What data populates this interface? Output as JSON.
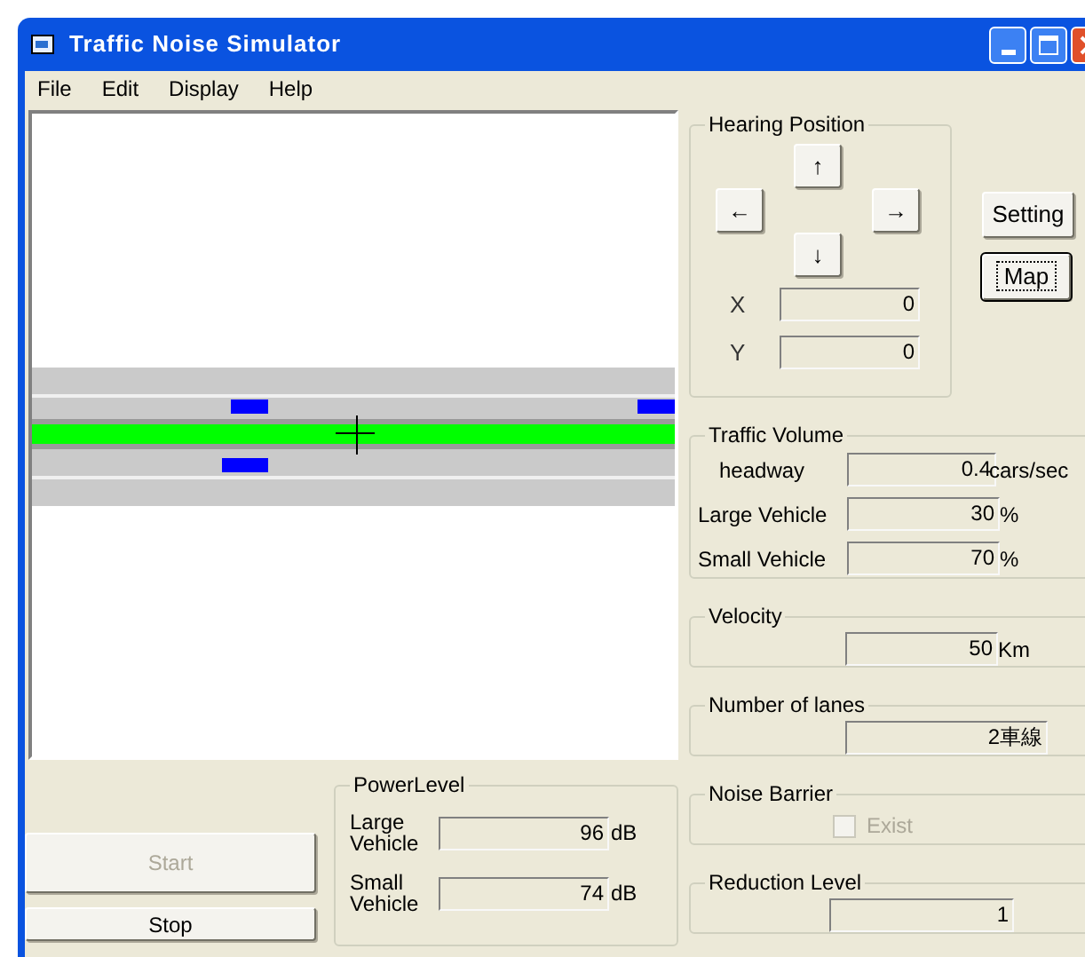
{
  "window": {
    "title": "Traffic Noise Simulator"
  },
  "menu": [
    "File",
    "Edit",
    "Display",
    "Help"
  ],
  "hearing_position": {
    "title": "Hearing Position",
    "up": "↑",
    "left": "←",
    "right": "→",
    "down": "↓",
    "fields": [
      {
        "label": "X",
        "value": "0"
      },
      {
        "label": "Y",
        "value": "0"
      }
    ]
  },
  "side_buttons": [
    {
      "label": "Setting",
      "focused": false
    },
    {
      "label": "Map",
      "focused": true
    }
  ],
  "traffic_volume": {
    "title": "Traffic Volume",
    "rows": [
      {
        "label": "headway",
        "value": "0.4",
        "unit": "cars/sec"
      },
      {
        "label": "Large Vehicle",
        "value": "30",
        "unit": "%"
      },
      {
        "label": "Small Vehicle",
        "value": "70",
        "unit": "%"
      }
    ]
  },
  "velocity": {
    "title": "Velocity",
    "value": "50",
    "unit": "Km"
  },
  "lanes": {
    "title": "Number of lanes",
    "value": "2車線"
  },
  "noise_barrier": {
    "title": "Noise Barrier",
    "label": "Exist",
    "checked": false,
    "disabled": true
  },
  "reduction_level": {
    "title": "Reduction Level",
    "value": "1"
  },
  "controls": [
    {
      "label": "Start",
      "disabled": true
    },
    {
      "label": "Stop",
      "disabled": false
    }
  ],
  "power_level": {
    "title": "PowerLevel",
    "rows": [
      {
        "label": "Large Vehicle",
        "value": "96",
        "unit": "dB"
      },
      {
        "label": "Small Vehicle",
        "value": "74",
        "unit": "dB"
      }
    ]
  }
}
